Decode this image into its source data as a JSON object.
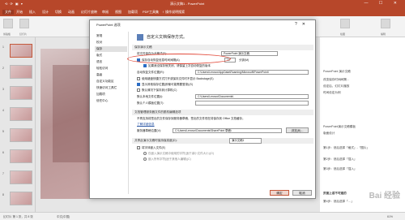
{
  "window": {
    "title": "演示文稿1 - PowerPoint",
    "qat": "⟲ ⟳ ▣ ▾",
    "controls": "—  ☐  ✕"
  },
  "ribbon_tabs": [
    "文件",
    "开始",
    "插入",
    "设计",
    "切换",
    "动画",
    "幻灯片放映",
    "审阅",
    "视图",
    "加载项",
    "PDF工具集",
    "♀ 操作说明搜索"
  ],
  "ribbon_groups": [
    "剪贴板",
    "幻灯片",
    "字体",
    "段落",
    "绘图",
    "编辑"
  ],
  "slide_numbers": [
    "1",
    "2",
    "3",
    "4",
    "5",
    "6",
    "7",
    "8"
  ],
  "dialog": {
    "title": "PowerPoint 选项",
    "help": "?",
    "close": "✕",
    "nav": [
      "常规",
      "校对",
      "保存",
      "版式",
      "语言",
      "轻松访问",
      "高级",
      "自定义功能区",
      "快速访问工具栏",
      "加载项",
      "信任中心"
    ],
    "nav_active_index": 2,
    "heading": "自定义文档保存方式。",
    "sections": {
      "save": "保存演示文稿",
      "offline": "文档管理服务器文件的脱机编辑选项",
      "fidelity": "共享此演示文稿时保持保真度(D):",
      "cache": "缓存设置"
    },
    "rows": {
      "format_label": "将文件保存为此格式(F):",
      "format_value": "PowerPoint 演示文稿",
      "autorecover_label": "保存自动恢复信息时间间隔(A)",
      "autorecover_value": "10",
      "autorecover_unit": "分钟(M)",
      "keep_last_label": "如果我没保存就关闭，请保留上次自动恢复的版本",
      "autorecover_loc_label": "自动恢复文件位置(R):",
      "autorecover_loc_value": "C:\\Users\\Lenovo\\AppData\\Roaming\\Microsoft\\PowerPoint\\",
      "no_backstage_label": "使用键盘快捷方式打开或保存文件时不显示 Backstage(S)",
      "show_more_label": "显示其他保存位置(即使可能需要登录)(S)",
      "default_computer_label": "默认情况下保存到计算机(C)",
      "local_loc_label": "默认本地文件位置(I):",
      "local_loc_value": "C:\\Users\\Lenovo\\Documents\\",
      "personal_tpl_label": "默认个人模板位置(T):",
      "personal_tpl_value": "",
      "offline_desc": "不再支持将签出的文件保存到服务器草稿，签出的文件现在将保存到 Office 文档缓存。",
      "offline_link": "了解详细信息",
      "server_draft_label": "服务器草稿位置(V):",
      "server_draft_value": "C:\\Users\\Lenovo\\Documents\\SharePoint 草稿\\",
      "browse": "浏览(B)...",
      "fidelity_file": "演示文稿1",
      "embed_fonts_label": "将字体嵌入文件(E)",
      "embed_opt1": "仅嵌入演示文稿中使用的字符(适于减小文件大小)(O)",
      "embed_opt2": "嵌入所有字符(适于其他人编辑)(C)"
    },
    "ok": "确定",
    "cancel": "取消"
  },
  "right_pane": [
    "PowerPoint 演示文稿",
    "改变保存时间间隔…",
    "设定后，幻灯片播放",
    "时间设定为例",
    "",
    "PowerPoint演示文稿模板",
    "版面设计",
    "第1步：然后选择「格式」-「图片」",
    "第2步：然后选择「插入」",
    "第3步：然后选择「插入」",
    "",
    "页面上或不可遗的",
    "第4步：然后选择「…」"
  ],
  "status": {
    "slide": "幻灯片 第 1 张，共 8 张",
    "lang": "中文(中国)",
    "zoom": "61%"
  },
  "watermark": "Bai 经验"
}
